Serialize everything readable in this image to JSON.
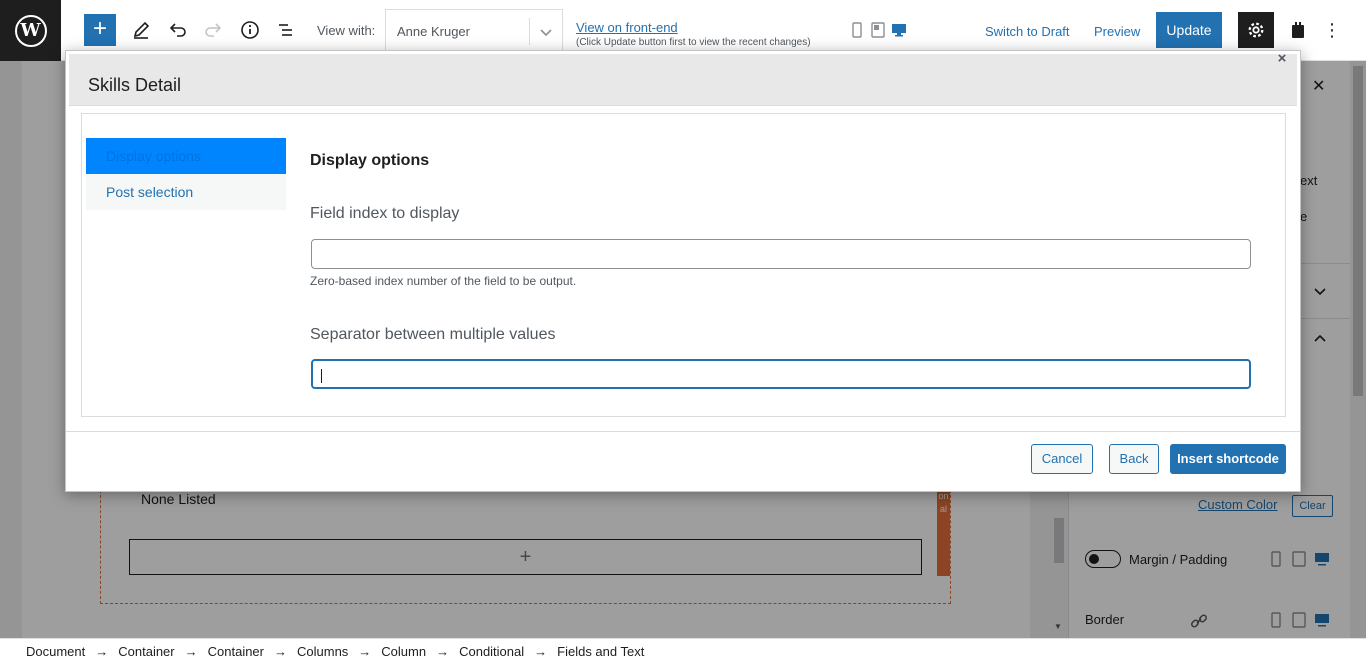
{
  "toolbar": {
    "view_with_label": "View with:",
    "view_with_value": "Anne Kruger",
    "frontend_link": "View on front-end",
    "frontend_note": "(Click Update button first to view the recent changes)",
    "switch_to_draft": "Switch to Draft",
    "preview": "Preview",
    "update": "Update",
    "add_symbol": "+"
  },
  "canvas": {
    "none_listed": "None Listed",
    "appender_symbol": "+",
    "conditional_tab": "onal"
  },
  "sidebar": {
    "fragments": [
      "ext",
      "e"
    ],
    "custom_color": "Custom Color",
    "clear": "Clear",
    "margin_padding": "Margin / Padding",
    "border": "Border"
  },
  "breadcrumb": {
    "items": [
      "Document",
      "Container",
      "Container",
      "Columns",
      "Column",
      "Conditional",
      "Fields and Text"
    ],
    "separator": "→"
  },
  "modal": {
    "title": "Skills Detail",
    "close_symbol": "×",
    "tabs": [
      {
        "label": "Display options",
        "active": true
      },
      {
        "label": "Post selection",
        "active": false
      }
    ],
    "panel_heading": "Display options",
    "fields": [
      {
        "label": "Field index to display",
        "value": "",
        "help": "Zero-based index number of the field to be output."
      },
      {
        "label": "Separator between multiple values",
        "value": "",
        "help": ""
      }
    ],
    "buttons": {
      "cancel": "Cancel",
      "back": "Back",
      "insert": "Insert shortcode"
    }
  },
  "colors": {
    "accent": "#2271b1",
    "active_tab": "#0085ff",
    "conditional": "#e26f3a"
  }
}
